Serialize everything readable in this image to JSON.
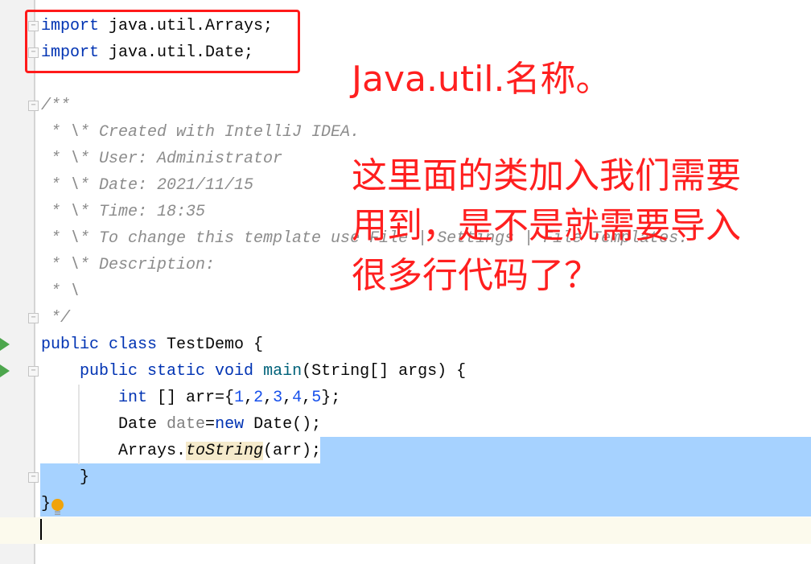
{
  "editor": {
    "lines": [
      [
        [
          "import",
          "kw"
        ],
        [
          " java.util.Arrays;",
          ""
        ]
      ],
      [
        [
          "import",
          "kw"
        ],
        [
          " java.util.Date;",
          ""
        ]
      ],
      [],
      [
        [
          "/**",
          "cm"
        ]
      ],
      [
        [
          " * \\* Created with IntelliJ IDEA.",
          "cm"
        ]
      ],
      [
        [
          " * \\* User: Administrator",
          "cm"
        ]
      ],
      [
        [
          " * \\* Date: 2021/11/15",
          "cm"
        ]
      ],
      [
        [
          " * \\* Time: 18:35",
          "cm"
        ]
      ],
      [
        [
          " * \\* To change this template use File | Settings | File Templates.",
          "cm"
        ]
      ],
      [
        [
          " * \\* Description:",
          "cm"
        ]
      ],
      [
        [
          " * \\",
          "cm"
        ]
      ],
      [
        [
          " */",
          "cm"
        ]
      ],
      [
        [
          "public class",
          "kw"
        ],
        [
          " TestDemo {",
          ""
        ]
      ],
      [
        [
          "    ",
          ""
        ],
        [
          "public static void",
          "kw"
        ],
        [
          " ",
          ""
        ],
        [
          "main",
          "fn"
        ],
        [
          "(String[] args) {",
          ""
        ]
      ],
      [
        [
          "        ",
          ""
        ],
        [
          "int",
          "kw"
        ],
        [
          " [] arr={",
          ""
        ],
        [
          "1",
          "num"
        ],
        [
          ",",
          ""
        ],
        [
          "2",
          "num"
        ],
        [
          ",",
          ""
        ],
        [
          "3",
          "num"
        ],
        [
          ",",
          ""
        ],
        [
          "4",
          "num"
        ],
        [
          ",",
          ""
        ],
        [
          "5",
          "num"
        ],
        [
          "};",
          ""
        ]
      ],
      [
        [
          "        Date ",
          ""
        ],
        [
          "date",
          "unused"
        ],
        [
          "=",
          ""
        ],
        [
          "new",
          "kw"
        ],
        [
          " Date();",
          ""
        ]
      ],
      [
        [
          "        Arrays.",
          ""
        ],
        [
          "toString",
          "st"
        ],
        [
          "(arr);",
          ""
        ]
      ],
      [
        [
          "    }",
          ""
        ]
      ],
      [
        [
          "}",
          ""
        ]
      ],
      []
    ],
    "selection_color": "#a6d2ff",
    "current_line_color": "#fcfaed"
  },
  "annotations": {
    "title": "Java.util.名称。",
    "body_lines": [
      "这里面的类加入我们需要",
      "用到，是不是就需要导入",
      "很多行代码了？"
    ],
    "color": "#ff1f1f"
  }
}
